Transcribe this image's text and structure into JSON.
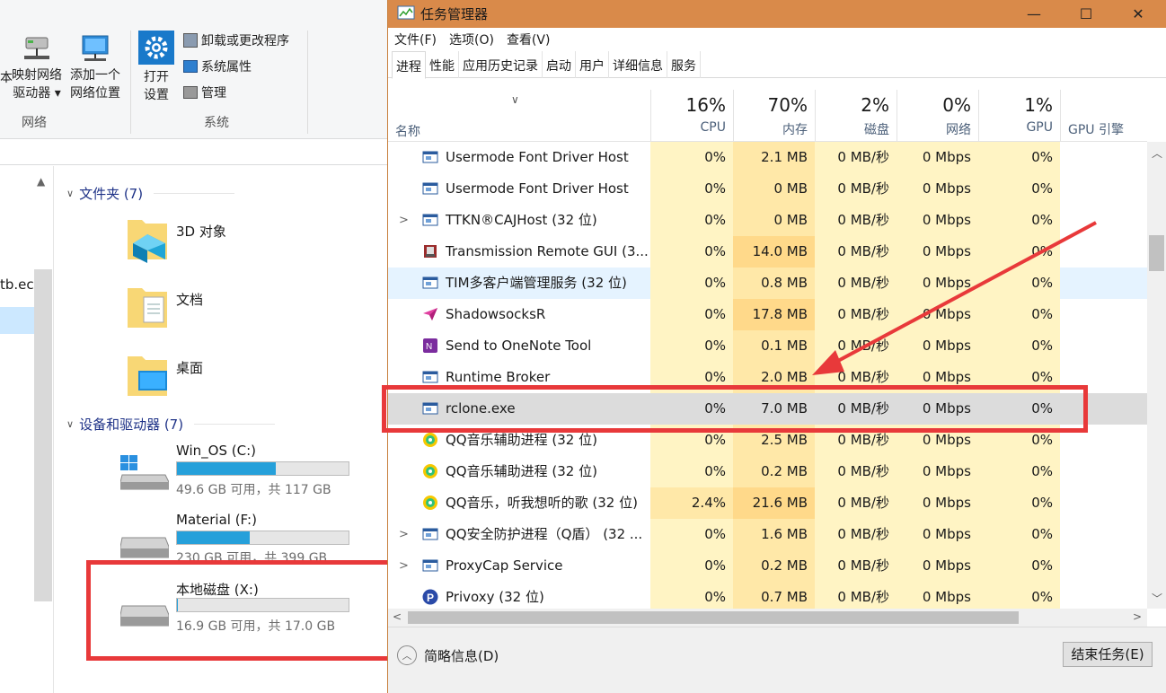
{
  "explorer": {
    "ribbon": {
      "map_drive": "映射网络\n驱动器",
      "map_drive_line1": "映射网络",
      "map_drive_line2": "驱动器",
      "add_location_line1": "添加一个",
      "add_location_line2": "网络位置",
      "open_settings_line1": "打开",
      "open_settings_line2": "设置",
      "uninstall": "卸载或更改程序",
      "system_props": "系统属性",
      "manage": "管理",
      "group_network": "网络",
      "group_system": "系统",
      "frag_left": "本"
    },
    "nav": {
      "frag": "tb.ec"
    },
    "folders_header": "文件夹 (7)",
    "folders": [
      {
        "name": "3D 对象"
      },
      {
        "name": "文档"
      },
      {
        "name": "桌面"
      }
    ],
    "devices_header": "设备和驱动器 (7)",
    "drives": [
      {
        "name": "Win_OS (C:)",
        "info": "49.6 GB 可用，共 117 GB",
        "used_fraction": 0.576
      },
      {
        "name": "Material (F:)",
        "info": "230 GB 可用，共 399 GB",
        "used_fraction": 0.424
      },
      {
        "name": "本地磁盘 (X:)",
        "info": "16.9 GB 可用，共 17.0 GB",
        "used_fraction": 0.006
      }
    ]
  },
  "taskmgr": {
    "title": "任务管理器",
    "menu": [
      "文件(F)",
      "选项(O)",
      "查看(V)"
    ],
    "tabs": [
      "进程",
      "性能",
      "应用历史记录",
      "启动",
      "用户",
      "详细信息",
      "服务"
    ],
    "columns": {
      "name": "名称",
      "cpu_pct": "16%",
      "cpu": "CPU",
      "mem_pct": "70%",
      "mem": "内存",
      "disk_pct": "2%",
      "disk": "磁盘",
      "net_pct": "0%",
      "net": "网络",
      "gpu_pct": "1%",
      "gpu": "GPU",
      "gpu_engine": "GPU 引擎"
    },
    "rows": [
      {
        "name": "Usermode Font Driver Host",
        "cpu": "0%",
        "mem": "2.1 MB",
        "disk": "0 MB/秒",
        "net": "0 Mbps",
        "gpu": "0%",
        "icon": "window-icon",
        "expand": ""
      },
      {
        "name": "Usermode Font Driver Host",
        "cpu": "0%",
        "mem": "0 MB",
        "disk": "0 MB/秒",
        "net": "0 Mbps",
        "gpu": "0%",
        "icon": "window-icon",
        "expand": ""
      },
      {
        "name": "TTKN®CAJHost (32 位)",
        "cpu": "0%",
        "mem": "0 MB",
        "disk": "0 MB/秒",
        "net": "0 Mbps",
        "gpu": "0%",
        "icon": "window-icon",
        "expand": ">"
      },
      {
        "name": "Transmission Remote GUI (3...",
        "cpu": "0%",
        "mem": "14.0 MB",
        "disk": "0 MB/秒",
        "net": "0 Mbps",
        "gpu": "0%",
        "icon": "transmission-icon",
        "expand": ""
      },
      {
        "name": "TIM多客户端管理服务 (32 位)",
        "cpu": "0%",
        "mem": "0.8 MB",
        "disk": "0 MB/秒",
        "net": "0 Mbps",
        "gpu": "0%",
        "icon": "window-icon",
        "expand": ""
      },
      {
        "name": "ShadowsocksR",
        "cpu": "0%",
        "mem": "17.8 MB",
        "disk": "0 MB/秒",
        "net": "0 Mbps",
        "gpu": "0%",
        "icon": "paper-plane-icon",
        "expand": ""
      },
      {
        "name": "Send to OneNote Tool",
        "cpu": "0%",
        "mem": "0.1 MB",
        "disk": "0 MB/秒",
        "net": "0 Mbps",
        "gpu": "0%",
        "icon": "onenote-icon",
        "expand": ""
      },
      {
        "name": "Runtime Broker",
        "cpu": "0%",
        "mem": "2.0 MB",
        "disk": "0 MB/秒",
        "net": "0 Mbps",
        "gpu": "0%",
        "icon": "window-icon",
        "expand": ""
      },
      {
        "name": "rclone.exe",
        "cpu": "0%",
        "mem": "7.0 MB",
        "disk": "0 MB/秒",
        "net": "0 Mbps",
        "gpu": "0%",
        "icon": "window-icon",
        "expand": ""
      },
      {
        "name": "QQ音乐辅助进程 (32 位)",
        "cpu": "0%",
        "mem": "2.5 MB",
        "disk": "0 MB/秒",
        "net": "0 Mbps",
        "gpu": "0%",
        "icon": "qqmusic-icon",
        "expand": ""
      },
      {
        "name": "QQ音乐辅助进程 (32 位)",
        "cpu": "0%",
        "mem": "0.2 MB",
        "disk": "0 MB/秒",
        "net": "0 Mbps",
        "gpu": "0%",
        "icon": "qqmusic-icon",
        "expand": ""
      },
      {
        "name": "QQ音乐，听我想听的歌 (32 位)",
        "cpu": "2.4%",
        "mem": "21.6 MB",
        "disk": "0 MB/秒",
        "net": "0 Mbps",
        "gpu": "0%",
        "icon": "qqmusic-icon",
        "expand": ""
      },
      {
        "name": "QQ安全防护进程（Q盾） (32 ...",
        "cpu": "0%",
        "mem": "1.6 MB",
        "disk": "0 MB/秒",
        "net": "0 Mbps",
        "gpu": "0%",
        "icon": "window-icon",
        "expand": ">"
      },
      {
        "name": "ProxyCap Service",
        "cpu": "0%",
        "mem": "0.2 MB",
        "disk": "0 MB/秒",
        "net": "0 Mbps",
        "gpu": "0%",
        "icon": "window-icon",
        "expand": ">"
      },
      {
        "name": "Privoxy (32 位)",
        "cpu": "0%",
        "mem": "0.7 MB",
        "disk": "0 MB/秒",
        "net": "0 Mbps",
        "gpu": "0%",
        "icon": "privoxy-icon",
        "expand": ""
      }
    ],
    "footer": {
      "brief": "简略信息(D)",
      "end_task": "结束任务(E)"
    },
    "colors": {
      "title_bar": "#d98a4a",
      "cpu_cell": "#fff4c4",
      "mem_cell": "#ffe8a8",
      "annotation_red": "#e8393a",
      "drive_fill": "#26a0da"
    }
  }
}
